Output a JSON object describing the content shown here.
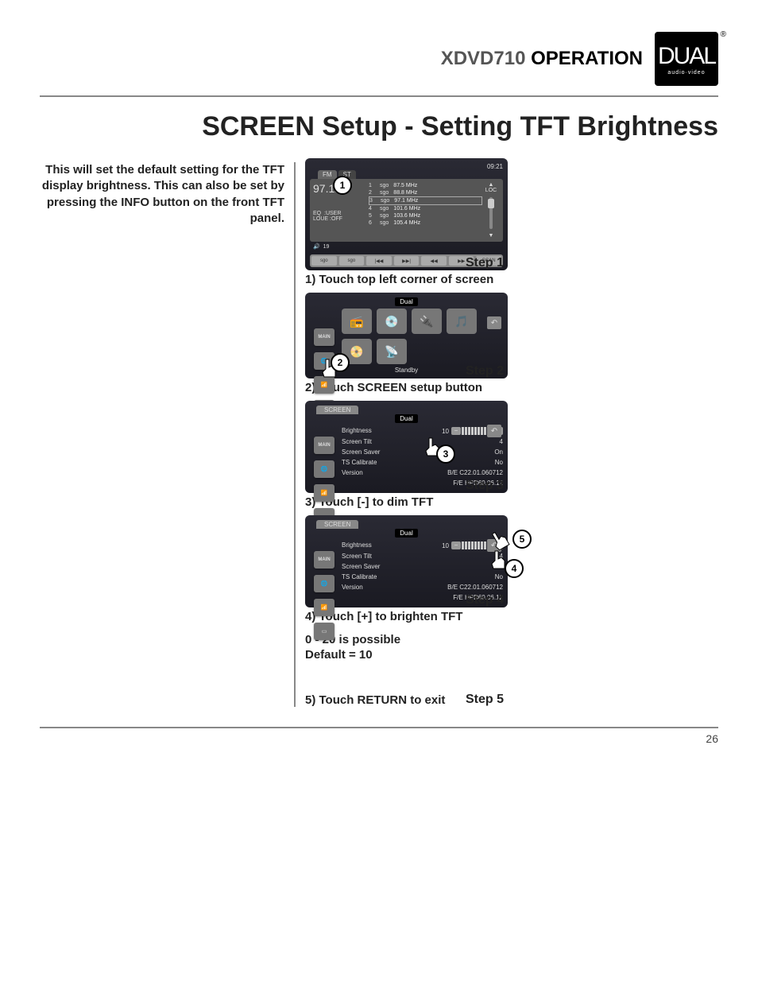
{
  "header": {
    "model": "XDVD710",
    "section": "OPERATION",
    "logo_text": "DUAL",
    "logo_sub": "audio·video"
  },
  "title": "SCREEN Setup - Setting TFT Brightness",
  "intro": "This will set the default setting for the TFT display brightness. This can also be set by pressing the INFO button on the front TFT panel.",
  "steps": {
    "s1": {
      "label": "Step 1",
      "caption": "1) Touch top left corner of screen"
    },
    "s2": {
      "label": "Step 2",
      "caption": "2) Touch SCREEN setup button"
    },
    "s3": {
      "label": "Step 3",
      "caption": "3) Touch [-] to dim TFT"
    },
    "s4": {
      "label": "Step 4",
      "caption": "4) Touch [+] to brighten TFT"
    },
    "s5": {
      "label": "Step 5",
      "caption": "5) Touch RETURN to exit"
    }
  },
  "info": {
    "range": "0 - 20 is possible",
    "default": "Default = 10"
  },
  "radio_screen": {
    "time": "09:21",
    "band_fm": "FM",
    "band_st": "ST",
    "freq_main": "97.1",
    "freq_unit": "Hz",
    "loc": "LOC",
    "eq_label": "EQ",
    "eq_val": ":USER",
    "loud_label": "LOUE",
    "loud_val": ":OFF",
    "vol_icon": "🔊",
    "vol_val": "19",
    "presets": [
      {
        "n": "1",
        "label": "sgo",
        "freq": "87.5 MHz"
      },
      {
        "n": "2",
        "label": "sgo",
        "freq": "88.8 MHz"
      },
      {
        "n": "3",
        "label": "sgo",
        "freq": "97.1 MHz"
      },
      {
        "n": "4",
        "label": "sgo",
        "freq": "101.6 MHz"
      },
      {
        "n": "5",
        "label": "sgo",
        "freq": "103.6 MHz"
      },
      {
        "n": "6",
        "label": "sgo",
        "freq": "105.4 MHz"
      }
    ],
    "bottom": [
      "sgo",
      "sgo",
      "|◀◀",
      "▶▶|",
      "◀◀",
      "▶▶",
      "SCAN"
    ]
  },
  "main_menu": {
    "tab": "MAIN",
    "brand": "Dual",
    "standby": "Standby",
    "main_btn": "MAIN"
  },
  "screen_menu": {
    "tab": "SCREEN",
    "brand": "Dual",
    "main_btn": "MAIN",
    "rows": {
      "brightness": {
        "label": "Brightness",
        "val": "10"
      },
      "tilt": {
        "label": "Screen Tilt",
        "val": "4"
      },
      "saver": {
        "label": "Screen Saver",
        "val": "On"
      },
      "ts": {
        "label": "TS Calibrate",
        "val": "No"
      },
      "version": {
        "label": "Version",
        "be": "B/E C22.01.060712",
        "fe": "F/E HPD60.06.12"
      }
    }
  },
  "callouts": {
    "c1": "1",
    "c2": "2",
    "c3": "3",
    "c4": "4",
    "c5": "5"
  },
  "page_number": "26"
}
